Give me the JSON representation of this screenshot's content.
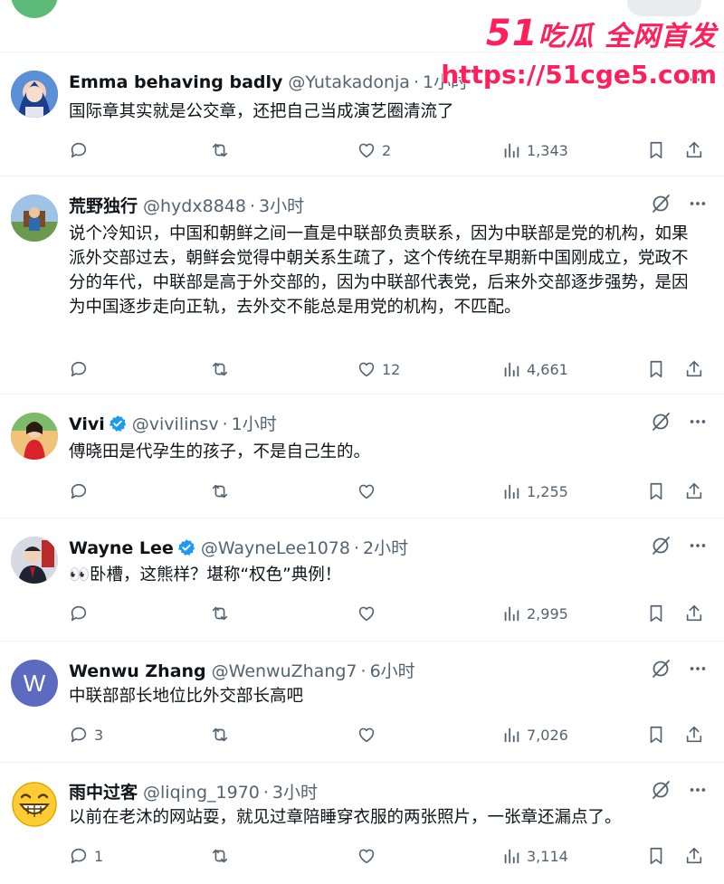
{
  "watermark": {
    "brand_num": "51",
    "brand_text": "吃瓜 全网首发",
    "url": "https://51cge5.com"
  },
  "tweets": [
    {
      "name": "Emma behaving badly",
      "handle": "@Yutakadonja",
      "sep": "·",
      "time": "1小时",
      "verified": false,
      "text": "国际章其实就是公交章，还把自己当成演艺圈清流了",
      "replies": "",
      "retweets": "",
      "likes": "2",
      "views": "1,343"
    },
    {
      "name": "荒野独行",
      "handle": "@hydx8848",
      "sep": "·",
      "time": "3小时",
      "verified": false,
      "text": "说个冷知识，中国和朝鲜之间一直是中联部负责联系，因为中联部是党的机构，如果派外交部过去，朝鲜会觉得中朝关系生疏了，这个传统在早期新中国刚成立，党政不分的年代，中联部是高于外交部的，因为中联部代表党，后来外交部逐步强势，是因为中国逐步走向正轨，去外交不能总是用党的机构，不匹配。",
      "replies": "",
      "retweets": "",
      "likes": "12",
      "views": "4,661"
    },
    {
      "name": "Vivi",
      "handle": "@vivilinsv",
      "sep": "·",
      "time": "1小时",
      "verified": true,
      "text": "傅晓田是代孕生的孩子，不是自己生的。",
      "replies": "",
      "retweets": "",
      "likes": "",
      "views": "1,255"
    },
    {
      "name": "Wayne Lee",
      "handle": "@WayneLee1078",
      "sep": "·",
      "time": "2小时",
      "verified": true,
      "text": "👀卧槽，这熊样？堪称“权色”典例！",
      "replies": "",
      "retweets": "",
      "likes": "",
      "views": "2,995"
    },
    {
      "name": "Wenwu Zhang",
      "handle": "@WenwuZhang7",
      "sep": "·",
      "time": "6小时",
      "verified": false,
      "avatar_letter": "W",
      "text": "中联部部长地位比外交部长高吧",
      "replies": "3",
      "retweets": "",
      "likes": "",
      "views": "7,026"
    },
    {
      "name": "雨中过客",
      "handle": "@liqing_1970",
      "sep": "·",
      "time": "3小时",
      "verified": false,
      "text": "以前在老沐的网站耍，就见过章陪睡穿衣服的两张照片，一张章还漏点了。",
      "replies": "1",
      "retweets": "",
      "likes": "",
      "views": "3,114"
    }
  ],
  "colors": {
    "text": "#0f1419",
    "muted": "#536471",
    "verified": "#1d9bf0",
    "watermark": "#ff1f5a",
    "divider": "#eff3f4"
  },
  "icons": [
    "reply-icon",
    "retweet-icon",
    "like-icon",
    "views-icon",
    "bookmark-icon",
    "share-icon",
    "grok-icon",
    "more-icon",
    "verified-badge-icon"
  ]
}
